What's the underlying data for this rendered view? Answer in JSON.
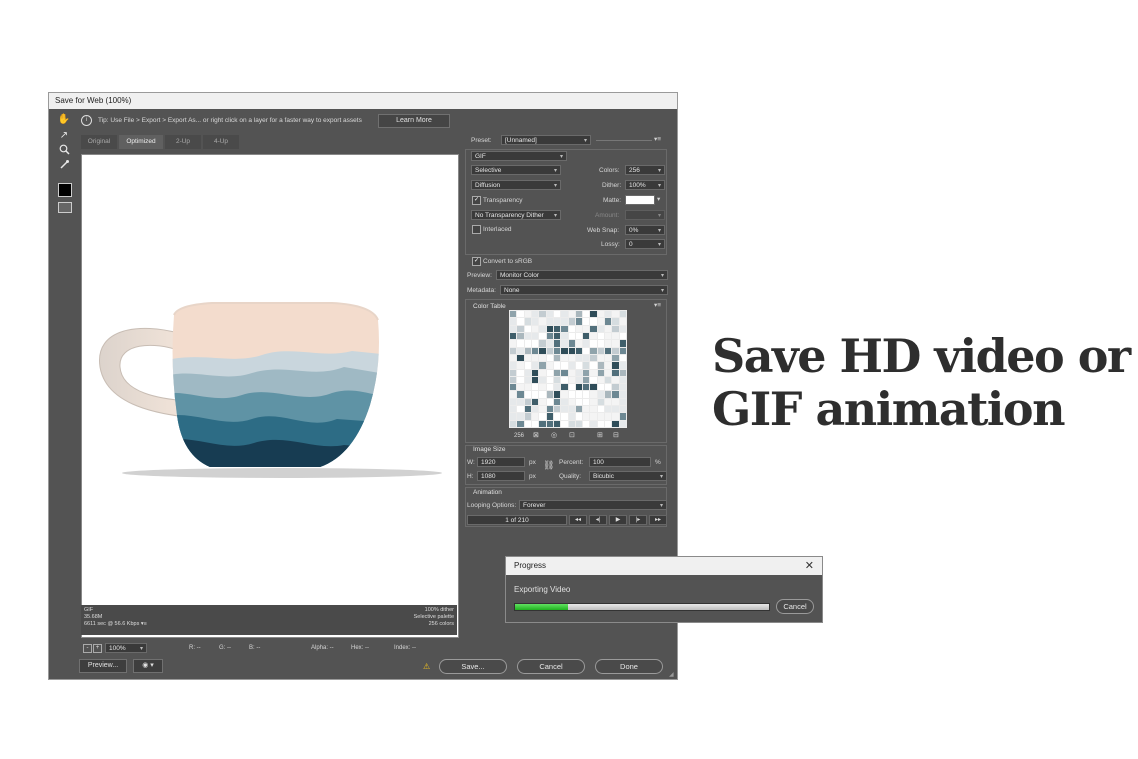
{
  "dialog": {
    "title": "Save for Web (100%)",
    "tip": "Tip: Use File > Export > Export As...  or right click on a layer for a faster way to export assets",
    "learn_more": "Learn More"
  },
  "tabs": [
    "Original",
    "Optimized",
    "2-Up",
    "4-Up"
  ],
  "preview_info": {
    "left": [
      "GIF",
      "35.68M",
      "6611 sec @ 56.6 Kbps"
    ],
    "right": [
      "100% dither",
      "Selective palette",
      "256 colors"
    ]
  },
  "settings": {
    "preset_label": "Preset:",
    "preset_value": "[Unnamed]",
    "format": "GIF",
    "reduction": "Selective",
    "dither_algo": "Diffusion",
    "transparency_label": "Transparency",
    "transparency_dither": "No Transparency Dither",
    "interlaced_label": "Interlaced",
    "colors_label": "Colors:",
    "colors_value": "256",
    "dither_label": "Dither:",
    "dither_value": "100%",
    "matte_label": "Matte:",
    "amount_label": "Amount:",
    "websnap_label": "Web Snap:",
    "websnap_value": "0%",
    "lossy_label": "Lossy:",
    "lossy_value": "0",
    "convert_label": "Convert to sRGB",
    "preview_label": "Preview:",
    "preview_value": "Monitor Color",
    "metadata_label": "Metadata:",
    "metadata_value": "None"
  },
  "color_table": {
    "title": "Color Table",
    "count": "256"
  },
  "image_size": {
    "title": "Image Size",
    "w_label": "W:",
    "w_value": "1920",
    "h_label": "H:",
    "h_value": "1080",
    "unit": "px",
    "percent_label": "Percent:",
    "percent_value": "100",
    "percent_unit": "%",
    "quality_label": "Quality:",
    "quality_value": "Bicubic"
  },
  "animation": {
    "title": "Animation",
    "looping_label": "Looping Options:",
    "looping_value": "Forever",
    "frame": "1 of 210"
  },
  "status_bar": {
    "zoom": "100%",
    "r": "R: --",
    "g": "G: --",
    "b": "B: --",
    "alpha": "Alpha: --",
    "hex": "Hex: --",
    "index": "Index: --"
  },
  "buttons": {
    "preview": "Preview...",
    "save": "Save...",
    "cancel": "Cancel",
    "done": "Done"
  },
  "progress": {
    "title": "Progress",
    "status": "Exporting Video",
    "cancel": "Cancel",
    "fraction": 0.21
  },
  "headline": "Save HD video or GIF animation"
}
